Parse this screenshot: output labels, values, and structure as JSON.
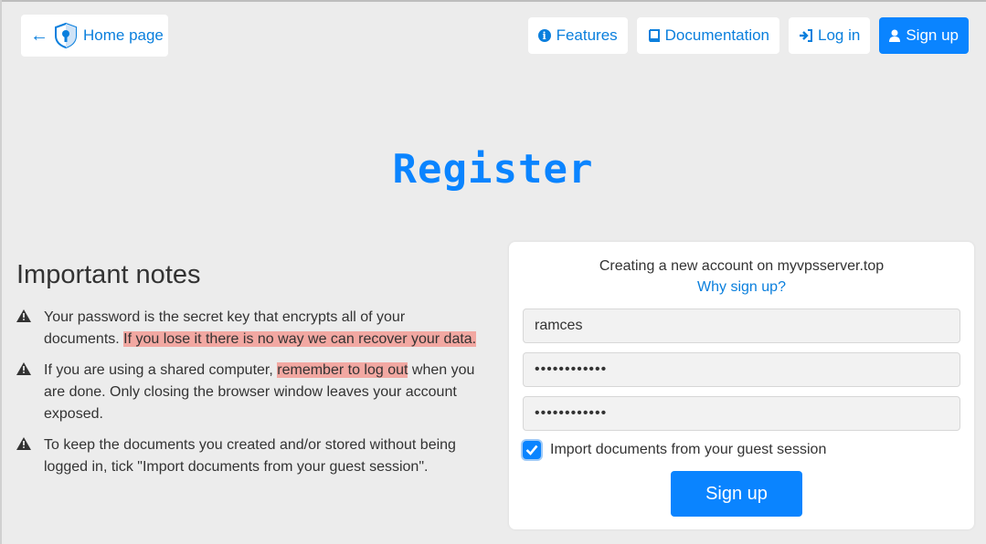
{
  "header": {
    "home_label": "Home page",
    "nav": [
      {
        "label": "Features",
        "icon": "info-icon"
      },
      {
        "label": "Documentation",
        "icon": "book-icon"
      },
      {
        "label": "Log in",
        "icon": "sign-in-icon"
      },
      {
        "label": "Sign up",
        "icon": "user-icon"
      }
    ]
  },
  "title": "Register",
  "notes": {
    "heading": "Important notes",
    "items": [
      {
        "pre": "Your password is the secret key that encrypts all of your documents. ",
        "highlight": "If you lose it there is no way we can recover your data.",
        "post": ""
      },
      {
        "pre": "If you are using a shared computer, ",
        "highlight": "remember to log out",
        "post": " when you are done. Only closing the browser window leaves your account exposed."
      },
      {
        "pre": "To keep the documents you created and/or stored without being logged in, tick \"Import documents from your guest session\".",
        "highlight": "",
        "post": ""
      }
    ]
  },
  "form": {
    "intro": "Creating a new account on myvpsserver.top",
    "why_link": "Why sign up?",
    "username": "ramces",
    "password": "••••••••••••",
    "password_confirm": "••••••••••••",
    "import_label": "Import documents from your guest session",
    "import_checked": true,
    "submit_label": "Sign up"
  },
  "colors": {
    "accent": "#0a84ff",
    "highlight": "#f2a8a2",
    "background": "#ececec"
  }
}
